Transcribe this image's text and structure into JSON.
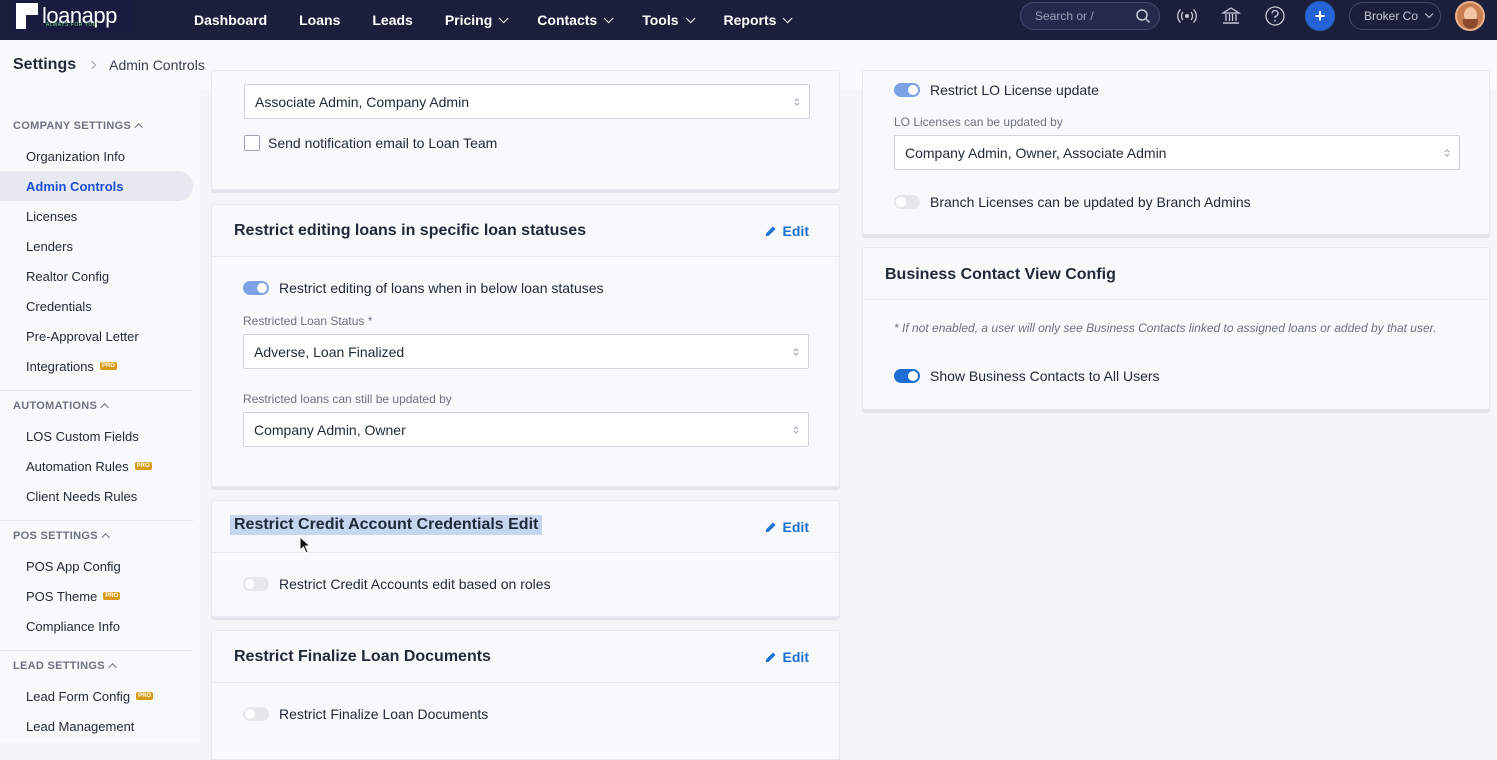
{
  "brand": {
    "name": "loanapp",
    "tagline": "ALWAYS FOR YOU"
  },
  "nav": {
    "items": [
      {
        "label": "Dashboard",
        "has_menu": false
      },
      {
        "label": "Loans",
        "has_menu": false
      },
      {
        "label": "Leads",
        "has_menu": false
      },
      {
        "label": "Pricing",
        "has_menu": true
      },
      {
        "label": "Contacts",
        "has_menu": true
      },
      {
        "label": "Tools",
        "has_menu": true
      },
      {
        "label": "Reports",
        "has_menu": true
      }
    ],
    "search_placeholder": "Search or /",
    "add_label": "+",
    "company": "Broker Co"
  },
  "breadcrumb": {
    "root": "Settings",
    "current": "Admin Controls"
  },
  "sidebar": {
    "sections": [
      {
        "title": "COMPANY SETTINGS",
        "items": [
          {
            "label": "Organization Info",
            "pro": false
          },
          {
            "label": "Admin Controls",
            "pro": false,
            "active": true
          },
          {
            "label": "Licenses",
            "pro": false
          },
          {
            "label": "Lenders",
            "pro": false
          },
          {
            "label": "Realtor Config",
            "pro": false
          },
          {
            "label": "Credentials",
            "pro": false
          },
          {
            "label": "Pre-Approval Letter",
            "pro": false
          },
          {
            "label": "Integrations",
            "pro": true
          }
        ]
      },
      {
        "title": "AUTOMATIONS",
        "items": [
          {
            "label": "LOS Custom Fields",
            "pro": false
          },
          {
            "label": "Automation Rules",
            "pro": true
          },
          {
            "label": "Client Needs Rules",
            "pro": false
          }
        ]
      },
      {
        "title": "POS SETTINGS",
        "items": [
          {
            "label": "POS App Config",
            "pro": false
          },
          {
            "label": "POS Theme",
            "pro": true
          },
          {
            "label": "Compliance Info",
            "pro": false
          }
        ]
      },
      {
        "title": "LEAD SETTINGS",
        "items": [
          {
            "label": "Lead Form Config",
            "pro": true
          },
          {
            "label": "Lead Management",
            "pro": false
          }
        ]
      }
    ],
    "pro_badge": "PRO"
  },
  "cards": {
    "top_partial": {
      "select_value": "Associate Admin, Company Admin",
      "checkbox_label": "Send notification email to Loan Team",
      "checked": false
    },
    "restrict_statuses": {
      "title": "Restrict editing loans in specific loan statuses",
      "edit_label": "Edit",
      "toggle_label": "Restrict editing of loans when in below loan statuses",
      "toggle_on": true,
      "status_label": "Restricted Loan Status *",
      "status_value": "Adverse, Loan Finalized",
      "updatable_label": "Restricted loans can still be updated by",
      "updatable_value": "Company Admin, Owner"
    },
    "restrict_credit": {
      "title": "Restrict Credit Account Credentials Edit",
      "edit_label": "Edit",
      "toggle_label": "Restrict Credit Accounts edit based on roles",
      "toggle_on": false
    },
    "restrict_finalize": {
      "title": "Restrict Finalize Loan Documents",
      "edit_label": "Edit",
      "toggle_label": "Restrict Finalize Loan Documents",
      "toggle_on": false
    },
    "lo_license": {
      "toggle_label": "Restrict LO License update",
      "toggle_on": true,
      "field_label": "LO Licenses can be updated by",
      "field_value": "Company Admin, Owner, Associate Admin",
      "branch_label": "Branch Licenses can be updated by Branch Admins",
      "branch_on": false
    },
    "business_contact": {
      "title": "Business Contact View Config",
      "note": "* If not enabled, a user will only see Business Contacts linked to assigned loans or added by that user.",
      "toggle_label": "Show Business Contacts to All Users",
      "toggle_on": true
    }
  },
  "colors": {
    "nav_bg": "#1b1f3b",
    "accent": "#1d6fd6",
    "pro_badge": "#d89b16",
    "highlight": "#c7d6f0"
  }
}
